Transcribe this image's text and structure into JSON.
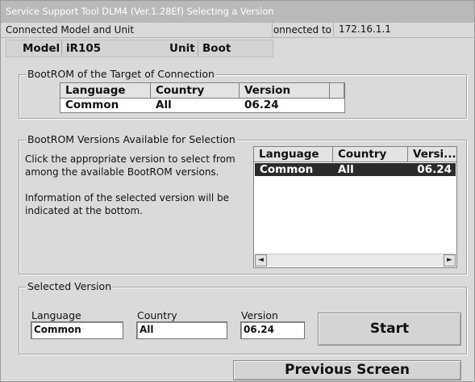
{
  "window": {
    "title": "Service Support Tool DLM4 (Ver.1.28Ef) Selecting a Version"
  },
  "connection": {
    "title": "Connected Model and Unit",
    "connected_to_label": "Connected to",
    "ip_address": "172.16.1.1",
    "model_label": "Model",
    "model_value": "iR105",
    "unit_label": "Unit",
    "unit_value": "Boot"
  },
  "target_group": {
    "title": "BootROM of the Target of Connection",
    "columns": [
      "Language",
      "Country",
      "Version"
    ],
    "row": {
      "language": "Common",
      "country": "All",
      "version": "06.24"
    }
  },
  "available_group": {
    "title": "BootROM Versions Available for Selection",
    "description_1_line_1": "Click the appropriate version to select from",
    "description_1_line_2": "among the available BootROM versions.",
    "description_2_line_1": "Information of the selected version will be",
    "description_2_line_2": "indicated at the bottom.",
    "columns": [
      "Language",
      "Country",
      "Versi..."
    ],
    "rows": [
      {
        "language": "Common",
        "country": "All",
        "version": "06.24",
        "selected": true
      }
    ],
    "scroll_left_icon": "◄",
    "scroll_right_icon": "►"
  },
  "selected_group": {
    "title": "Selected Version",
    "language_label": "Language",
    "language_value": "Common",
    "country_label": "Country",
    "country_value": "All",
    "version_label": "Version",
    "version_value": "06.24",
    "start_label": "Start"
  },
  "footer": {
    "previous_label": "Previous Screen"
  }
}
